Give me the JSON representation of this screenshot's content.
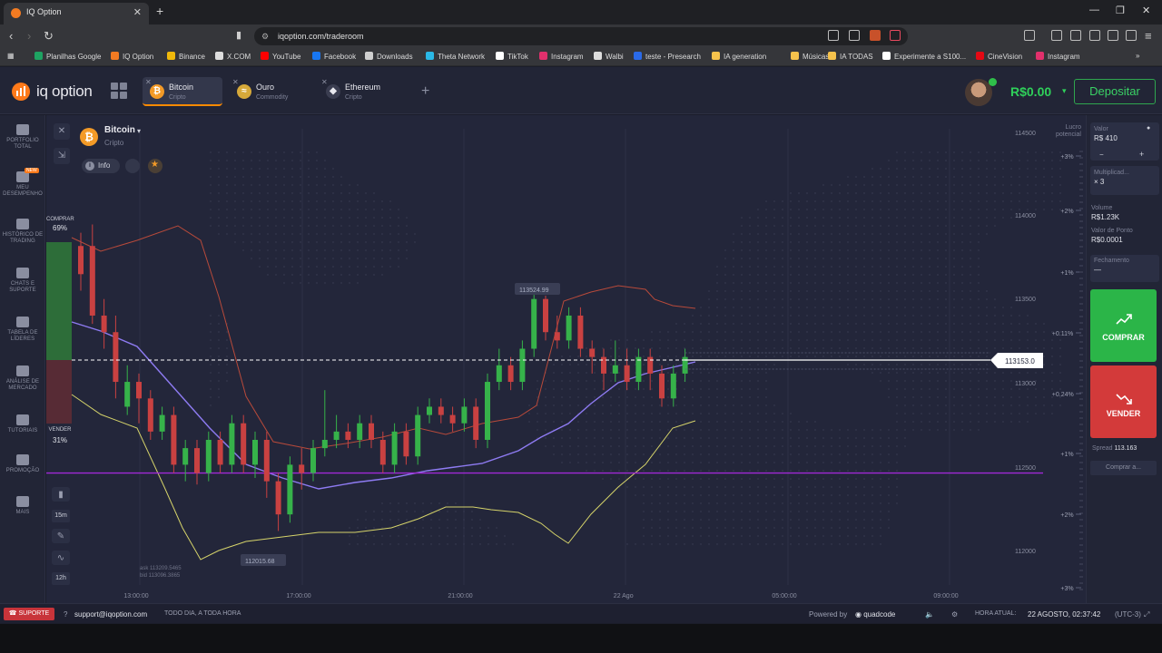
{
  "browser": {
    "tab_title": "IQ Option",
    "url": "iqoption.com/traderoom",
    "bookmarks": [
      {
        "label": "Planilhas Google",
        "color": "#1ea362"
      },
      {
        "label": "IQ Option",
        "color": "#f27b22"
      },
      {
        "label": "Binance",
        "color": "#f0b90b"
      },
      {
        "label": "X.COM",
        "color": "#dddddd"
      },
      {
        "label": "YouTube",
        "color": "#ff0000"
      },
      {
        "label": "Facebook",
        "color": "#1877f2"
      },
      {
        "label": "Downloads",
        "color": "#cfcfcf"
      },
      {
        "label": "Theta Network",
        "color": "#2ab8e6"
      },
      {
        "label": "TikTok",
        "color": "#ffffff"
      },
      {
        "label": "Instagram",
        "color": "#e1306c"
      },
      {
        "label": "Walbi",
        "color": "#dddddd"
      },
      {
        "label": "teste - Presearch",
        "color": "#2a6ae8"
      },
      {
        "label": "IA generation",
        "color": "#f5c24c"
      },
      {
        "label": "Músicas",
        "color": "#f5c24c"
      },
      {
        "label": "IA TODAS",
        "color": "#f5c24c"
      },
      {
        "label": "Experimente a S100...",
        "color": "#ffffff"
      },
      {
        "label": "CineVision",
        "color": "#e50914"
      },
      {
        "label": "Instagram",
        "color": "#e1306c"
      }
    ]
  },
  "app": {
    "logo": "iq option",
    "assets": [
      {
        "name": "Bitcoin",
        "sub": "Cripto",
        "symbol": "₿",
        "color": "#f39a27"
      },
      {
        "name": "Ouro",
        "sub": "Commodity",
        "symbol": "≈",
        "color": "#d6a93a"
      },
      {
        "name": "Ethereum",
        "sub": "Cripto",
        "symbol": "◆",
        "color": "#e9e9ef"
      }
    ],
    "balance": "R$0.00",
    "deposit_label": "Depositar"
  },
  "sidebar": {
    "items": [
      {
        "label": "PORTFOLIO TOTAL",
        "icon": "briefcase-icon"
      },
      {
        "label": "MEU DESEMPENHO",
        "icon": "chart-icon",
        "badge": "NEW"
      },
      {
        "label": "HISTÓRICO DE TRADING",
        "icon": "clock-icon"
      },
      {
        "label": "CHATS E SUPORTE",
        "icon": "chat-icon"
      },
      {
        "label": "TABELA DE LÍDERES",
        "icon": "trophy-icon"
      },
      {
        "label": "ANÁLISE DE MERCADO",
        "icon": "analysis-icon"
      },
      {
        "label": "TUTORIAIS",
        "icon": "graduation-icon"
      },
      {
        "label": "PROMOÇÃO",
        "icon": "rocket-icon"
      },
      {
        "label": "MAIS",
        "icon": "more-icon"
      }
    ]
  },
  "chart": {
    "asset_name": "Bitcoin",
    "asset_category": "Cripto",
    "info_label": "Info",
    "buy_label": "COMPRAR",
    "buy_pct": "69%",
    "sell_label": "VENDER",
    "sell_pct": "31%",
    "lucro_label": "Lucro potencial",
    "timeframe": "15m",
    "period": "12h",
    "ask": "ask 113209.5465",
    "bid": "bid 113096.3865",
    "high_label": "113524.99",
    "low_label": "112015.68",
    "current_price": "113153.0",
    "price_ticks": [
      "114500",
      "114000",
      "113500",
      "113000",
      "112500",
      "112000"
    ],
    "pct_ticks": [
      "+3%",
      "+2%",
      "+1%",
      "+0.11%",
      "+0.24%",
      "+1%",
      "+2%",
      "+3%"
    ],
    "time_ticks": [
      "13:00:00",
      "17:00:00",
      "21:00:00",
      "22 Ago",
      "05:00:00",
      "09:00:00"
    ]
  },
  "chart_data": {
    "type": "candlestick",
    "title": "Bitcoin",
    "interval": "15m",
    "ylim": [
      111900,
      114500
    ],
    "horizontal_line": 112450,
    "candles": [
      {
        "o": 113650,
        "c": 113820,
        "h": 113900,
        "l": 113550,
        "up": false
      },
      {
        "o": 113820,
        "c": 113400,
        "h": 113950,
        "l": 113350,
        "up": false
      },
      {
        "o": 113400,
        "c": 113300,
        "h": 113500,
        "l": 113200,
        "up": false
      },
      {
        "o": 113300,
        "c": 113000,
        "h": 113400,
        "l": 112900,
        "up": false
      },
      {
        "o": 112850,
        "c": 113000,
        "h": 113100,
        "l": 112800,
        "up": true
      },
      {
        "o": 113000,
        "c": 112900,
        "h": 113050,
        "l": 112750,
        "up": false
      },
      {
        "o": 112900,
        "c": 112700,
        "h": 112950,
        "l": 112650,
        "up": false
      },
      {
        "o": 112700,
        "c": 112800,
        "h": 112850,
        "l": 112650,
        "up": true
      },
      {
        "o": 112800,
        "c": 112500,
        "h": 112850,
        "l": 112450,
        "up": false
      },
      {
        "o": 112500,
        "c": 112600,
        "h": 112650,
        "l": 112400,
        "up": true
      },
      {
        "o": 112600,
        "c": 112450,
        "h": 112650,
        "l": 112380,
        "up": false
      },
      {
        "o": 112450,
        "c": 112650,
        "h": 112700,
        "l": 112400,
        "up": true
      },
      {
        "o": 112650,
        "c": 112500,
        "h": 112700,
        "l": 112450,
        "up": false
      },
      {
        "o": 112500,
        "c": 112750,
        "h": 112800,
        "l": 112450,
        "up": true
      },
      {
        "o": 112750,
        "c": 112500,
        "h": 112800,
        "l": 112450,
        "up": false
      },
      {
        "o": 112500,
        "c": 112650,
        "h": 112700,
        "l": 112420,
        "up": true
      },
      {
        "o": 112650,
        "c": 112400,
        "h": 112700,
        "l": 112300,
        "up": false
      },
      {
        "o": 112400,
        "c": 112200,
        "h": 112450,
        "l": 112100,
        "up": false
      },
      {
        "o": 112200,
        "c": 112500,
        "h": 112550,
        "l": 112150,
        "up": true
      },
      {
        "o": 112500,
        "c": 112450,
        "h": 112600,
        "l": 112350,
        "up": false
      },
      {
        "o": 112450,
        "c": 112600,
        "h": 112650,
        "l": 112400,
        "up": true
      },
      {
        "o": 112600,
        "c": 112650,
        "h": 112950,
        "l": 112550,
        "up": true
      },
      {
        "o": 112650,
        "c": 112700,
        "h": 112800,
        "l": 112600,
        "up": true
      },
      {
        "o": 112700,
        "c": 112650,
        "h": 112750,
        "l": 112600,
        "up": false
      },
      {
        "o": 112650,
        "c": 112750,
        "h": 112800,
        "l": 112600,
        "up": true
      },
      {
        "o": 112750,
        "c": 112650,
        "h": 112800,
        "l": 112600,
        "up": false
      },
      {
        "o": 112650,
        "c": 112500,
        "h": 112700,
        "l": 112450,
        "up": false
      },
      {
        "o": 112500,
        "c": 112700,
        "h": 112750,
        "l": 112450,
        "up": true
      },
      {
        "o": 112700,
        "c": 112550,
        "h": 112750,
        "l": 112500,
        "up": false
      },
      {
        "o": 112550,
        "c": 112800,
        "h": 112850,
        "l": 112500,
        "up": true
      },
      {
        "o": 112800,
        "c": 112850,
        "h": 112900,
        "l": 112750,
        "up": true
      },
      {
        "o": 112850,
        "c": 112800,
        "h": 112900,
        "l": 112750,
        "up": false
      },
      {
        "o": 112800,
        "c": 112750,
        "h": 112850,
        "l": 112700,
        "up": false
      },
      {
        "o": 112750,
        "c": 112850,
        "h": 112900,
        "l": 112700,
        "up": true
      },
      {
        "o": 112850,
        "c": 112650,
        "h": 112900,
        "l": 112600,
        "up": false
      },
      {
        "o": 112650,
        "c": 113000,
        "h": 113050,
        "l": 112600,
        "up": true
      },
      {
        "o": 113000,
        "c": 113100,
        "h": 113200,
        "l": 112950,
        "up": true
      },
      {
        "o": 113100,
        "c": 113000,
        "h": 113150,
        "l": 112950,
        "up": false
      },
      {
        "o": 113000,
        "c": 113200,
        "h": 113250,
        "l": 112950,
        "up": true
      },
      {
        "o": 113200,
        "c": 113500,
        "h": 113525,
        "l": 113150,
        "up": true
      },
      {
        "o": 113500,
        "c": 113300,
        "h": 113520,
        "l": 113250,
        "up": false
      },
      {
        "o": 113300,
        "c": 113250,
        "h": 113400,
        "l": 113200,
        "up": false
      },
      {
        "o": 113250,
        "c": 113400,
        "h": 113450,
        "l": 113200,
        "up": true
      },
      {
        "o": 113400,
        "c": 113200,
        "h": 113450,
        "l": 113150,
        "up": false
      },
      {
        "o": 113200,
        "c": 113150,
        "h": 113250,
        "l": 113050,
        "up": false
      },
      {
        "o": 113150,
        "c": 113050,
        "h": 113200,
        "l": 112950,
        "up": false
      },
      {
        "o": 113050,
        "c": 113100,
        "h": 113250,
        "l": 113000,
        "up": true
      },
      {
        "o": 113100,
        "c": 113000,
        "h": 113200,
        "l": 112950,
        "up": false
      },
      {
        "o": 113000,
        "c": 113150,
        "h": 113200,
        "l": 112950,
        "up": true
      },
      {
        "o": 113150,
        "c": 113050,
        "h": 113200,
        "l": 112950,
        "up": false
      },
      {
        "o": 113050,
        "c": 112900,
        "h": 113100,
        "l": 112850,
        "up": false
      },
      {
        "o": 112900,
        "c": 113050,
        "h": 113100,
        "l": 112850,
        "up": true
      },
      {
        "o": 113050,
        "c": 113150,
        "h": 113200,
        "l": 113000,
        "up": true
      }
    ]
  },
  "panel": {
    "valor_label": "Valor",
    "valor": "R$ 410",
    "minus": "−",
    "plus": "+",
    "mult_label": "Multiplicad...",
    "mult": "× 3",
    "volume_label": "Volume",
    "volume": "R$1.23K",
    "ponto_label": "Valor de Ponto",
    "ponto": "R$0.0001",
    "fech_label": "Fechamento",
    "fech": "—",
    "buy": "COMPRAR",
    "sell": "VENDER",
    "spread_label": "Spread",
    "spread": "113.163",
    "buy_at": "Comprar a..."
  },
  "footer": {
    "support": "SUPORTE",
    "email": "support@iqoption.com",
    "tagline": "TODO DIA, A TODA HORA",
    "powered": "Powered by",
    "brand": "quadcode",
    "time_label": "HORA ATUAL:",
    "time": "22 AGOSTO, 02:37:42",
    "tz": "(UTC-3)"
  }
}
